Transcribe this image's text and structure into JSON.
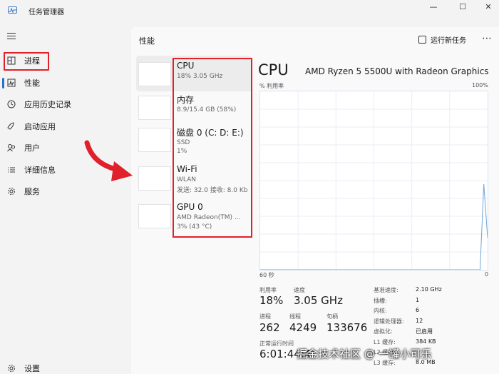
{
  "window": {
    "title": "任务管理器",
    "minimize_glyph": "—",
    "maximize_glyph": "☐",
    "close_glyph": "✕"
  },
  "sidebar": {
    "items": [
      {
        "label": "进程",
        "icon": "processes-icon"
      },
      {
        "label": "性能",
        "icon": "performance-icon",
        "active": true
      },
      {
        "label": "应用历史记录",
        "icon": "history-icon"
      },
      {
        "label": "启动应用",
        "icon": "startup-icon"
      },
      {
        "label": "用户",
        "icon": "users-icon"
      },
      {
        "label": "详细信息",
        "icon": "details-icon"
      },
      {
        "label": "服务",
        "icon": "services-icon"
      }
    ],
    "settings_label": "设置"
  },
  "header": {
    "title": "性能",
    "run_task_label": "运行新任务",
    "more_glyph": "⋯"
  },
  "devices": [
    {
      "name": "CPU",
      "lines": [
        "18%  3.05 GHz"
      ]
    },
    {
      "name": "内存",
      "lines": [
        "8.9/15.4 GB (58%)"
      ]
    },
    {
      "name": "磁盘 0 (C: D: E:)",
      "lines": [
        "SSD",
        "1%"
      ]
    },
    {
      "name": "Wi-Fi",
      "lines": [
        "WLAN",
        "发送: 32.0 接收: 8.0 Kb"
      ]
    },
    {
      "name": "GPU 0",
      "lines": [
        "AMD Radeon(TM) ...",
        "3% (43 °C)"
      ]
    }
  ],
  "cpu": {
    "title": "CPU",
    "model": "AMD Ryzen 5 5500U with Radeon Graphics",
    "util_label": "% 利用率",
    "max_label": "100%",
    "time_label": "60 秒",
    "zero_label": "0",
    "stats": {
      "util_label": "利用率",
      "util_value": "18%",
      "speed_label": "速度",
      "speed_value": "3.05 GHz",
      "proc_label": "进程",
      "proc_value": "262",
      "thread_label": "线程",
      "thread_value": "4249",
      "handle_label": "句柄",
      "handle_value": "133676",
      "uptime_label": "正常运行时间",
      "uptime_value": "6:01:44:4"
    },
    "specs": [
      {
        "label": "基准速度:",
        "value": "2.10 GHz"
      },
      {
        "label": "插槽:",
        "value": "1"
      },
      {
        "label": "内核:",
        "value": "6"
      },
      {
        "label": "逻辑处理器:",
        "value": "12"
      },
      {
        "label": "虚拟化:",
        "value": "已启用"
      },
      {
        "label": "L1 缓存:",
        "value": "384 KB"
      },
      {
        "label": "L2 缓存:",
        "value": ""
      },
      {
        "label": "L3 缓存:",
        "value": "8.0 MB"
      }
    ],
    "graph_series": [
      0,
      0,
      0,
      0,
      0,
      0,
      0,
      0,
      0,
      0,
      0,
      0,
      0,
      0,
      0,
      0,
      0,
      0,
      0,
      0,
      0,
      0,
      0,
      0,
      0,
      0,
      0,
      0,
      0,
      0,
      0,
      0,
      0,
      0,
      0,
      0,
      0,
      0,
      0,
      0,
      0,
      0,
      0,
      0,
      0,
      0,
      0,
      0,
      0,
      0,
      0,
      0,
      0,
      0,
      0,
      0,
      0,
      0,
      0,
      48,
      18
    ]
  },
  "watermark": "掘金技术社区 @ 一罐小可乐",
  "colors": {
    "accent": "#2b6fd1",
    "highlight": "#e0202a",
    "graph_line": "#6fa4d8"
  }
}
